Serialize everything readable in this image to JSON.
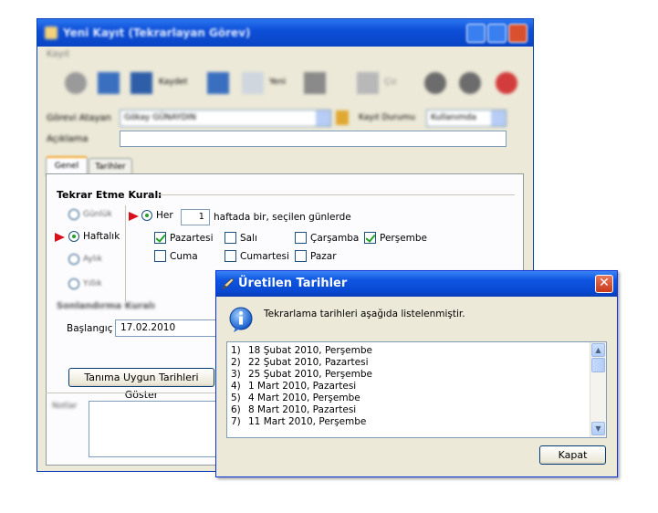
{
  "back_window": {
    "title": "Yeni Kayıt (Tekrarlayan Görev)",
    "menu": "Kayıt",
    "toolbar": {
      "save_label": "Kaydet",
      "new_label": "Yeni",
      "draw_label": "Çiz"
    },
    "assigned_label": "Görevi Atayan",
    "assigned_value": "Gökay GÜNAYDIN",
    "status_label": "Kayıt Durumu",
    "status_value": "Kullanımda",
    "desc_label": "Açıklama",
    "tabs": [
      "Genel",
      "Tarihler"
    ],
    "recurrence": {
      "heading": "Tekrar Etme Kuralı",
      "options": [
        "Günlük",
        "Haftalık",
        "Aylık",
        "Yıllık"
      ],
      "her_label": "Her",
      "interval": "1",
      "interval_suffix": "haftada bir, seçilen günlerde",
      "days": [
        {
          "label": "Pazartesi",
          "checked": true
        },
        {
          "label": "Salı",
          "checked": false
        },
        {
          "label": "Çarşamba",
          "checked": false
        },
        {
          "label": "Perşembe",
          "checked": true
        },
        {
          "label": "Cuma",
          "checked": false
        },
        {
          "label": "Cumartesi",
          "checked": false
        },
        {
          "label": "Pazar",
          "checked": false
        }
      ]
    },
    "end_rule_heading": "Sonlandırma Kuralı",
    "start_label": "Başlangıç",
    "start_value": "17.02.2010",
    "show_dates_button": "Tanıma Uygun Tarihleri Göster",
    "notes_label": "Notlar"
  },
  "dialog": {
    "title": "Üretilen Tarihler",
    "message": "Tekrarlama tarihleri aşağıda listelenmiştir.",
    "dates": [
      {
        "num": "1)",
        "text": "18 Şubat 2010, Perşembe"
      },
      {
        "num": "2)",
        "text": "22 Şubat 2010, Pazartesi"
      },
      {
        "num": "3)",
        "text": "25 Şubat 2010, Perşembe"
      },
      {
        "num": "4)",
        "text": "1 Mart 2010, Pazartesi"
      },
      {
        "num": "5)",
        "text": "4 Mart 2010, Perşembe"
      },
      {
        "num": "6)",
        "text": "8 Mart 2010, Pazartesi"
      },
      {
        "num": "7)",
        "text": "11 Mart 2010, Perşembe"
      }
    ],
    "close_button": "Kapat"
  }
}
